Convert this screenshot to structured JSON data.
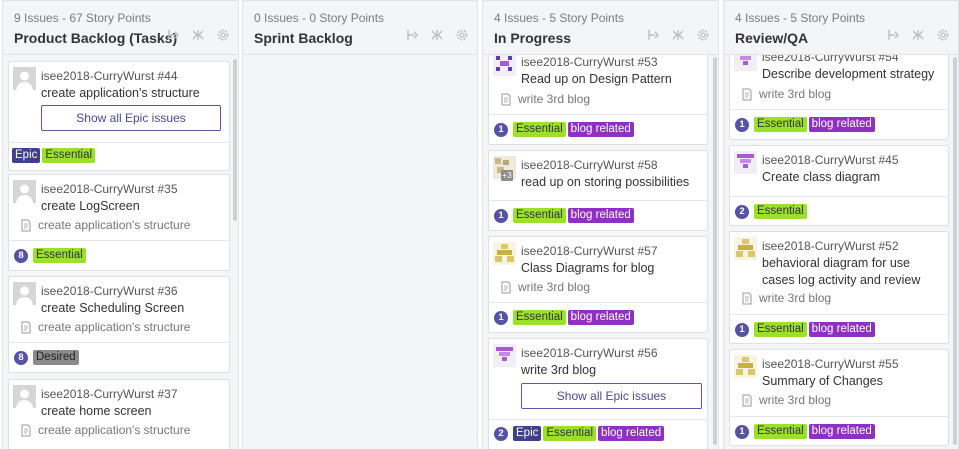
{
  "columns": [
    {
      "count": "9 Issues - 67 Story Points",
      "title": "Product Backlog (Tasks)",
      "cards": [
        {
          "ref": "isee2018-CurryWurst #44",
          "title": "create application's structure",
          "button": "Show all Epic issues",
          "labels": [
            "Epic",
            "Essential"
          ]
        },
        {
          "ref": "isee2018-CurryWurst #35",
          "title": "create LogScreen",
          "epic": "create application's structure",
          "points": "8",
          "labels": [
            "Essential"
          ]
        },
        {
          "ref": "isee2018-CurryWurst #36",
          "title": "create Scheduling Screen",
          "epic": "create application's structure",
          "points": "8",
          "labels": [
            "Desired"
          ]
        },
        {
          "ref": "isee2018-CurryWurst #37",
          "title": "create home screen",
          "epic": "create application's structure"
        }
      ]
    },
    {
      "count": "0 Issues - 0 Story Points",
      "title": "Sprint Backlog",
      "cards": []
    },
    {
      "count": "4 Issues - 5 Story Points",
      "title": "In Progress",
      "cards": [
        {
          "ref": "isee2018-CurryWurst #53",
          "title": "Read up on Design Pattern",
          "epic": "write 3rd blog",
          "points": "1",
          "labels": [
            "Essential",
            "blog related"
          ]
        },
        {
          "ref": "isee2018-CurryWurst #58",
          "title": "read up on storing possibilities",
          "avatar_badge": "+3",
          "points": "1",
          "labels": [
            "Essential",
            "blog related"
          ]
        },
        {
          "ref": "isee2018-CurryWurst #57",
          "title": "Class Diagrams for blog",
          "epic": "write 3rd blog",
          "points": "1",
          "labels": [
            "Essential",
            "blog related"
          ]
        },
        {
          "ref": "isee2018-CurryWurst #56",
          "title": "write 3rd blog",
          "button": "Show all Epic issues",
          "points": "2",
          "labels": [
            "Epic",
            "Essential",
            "blog related"
          ]
        }
      ]
    },
    {
      "count": "4 Issues - 5 Story Points",
      "title": "Review/QA",
      "cards": [
        {
          "ref": "isee2018-CurryWurst #54",
          "title": "Describe development strategy",
          "epic": "write 3rd blog",
          "points": "1",
          "labels": [
            "Essential",
            "blog related"
          ]
        },
        {
          "ref": "isee2018-CurryWurst #45",
          "title": "Create class diagram",
          "points": "2",
          "labels": [
            "Essential"
          ]
        },
        {
          "ref": "isee2018-CurryWurst #52",
          "title": "behavioral diagram for use cases log activity and review",
          "epic": "write 3rd blog",
          "points": "1",
          "labels": [
            "Essential",
            "blog related"
          ]
        },
        {
          "ref": "isee2018-CurryWurst #55",
          "title": "Summary of Changes",
          "epic": "write 3rd blog",
          "points": "1",
          "labels": [
            "Essential",
            "blog related"
          ]
        }
      ]
    }
  ],
  "tool_icons": [
    "pin-icon",
    "collapse-icon",
    "settings-icon"
  ],
  "colors": {
    "essential": "#9be12a",
    "blog_related": "#8f2fc4",
    "epic": "#3f3f8f",
    "desired": "#8c8c8c",
    "story_points": "#5553a6",
    "epic_button": "#5957a7"
  }
}
